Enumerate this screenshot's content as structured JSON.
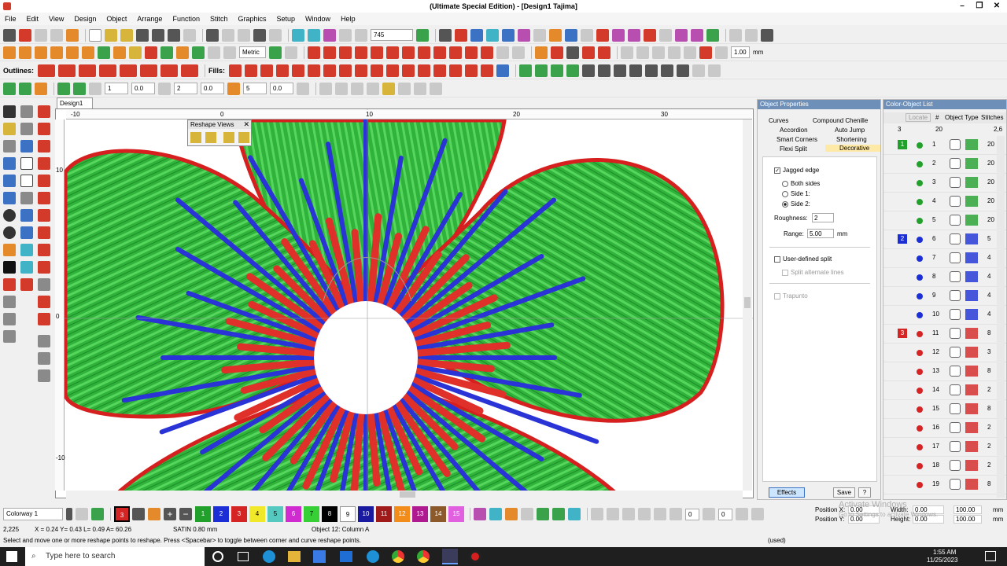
{
  "window": {
    "title": "(Ultimate Special Edition) - [Design1          Tajima]"
  },
  "menubar": {
    "items": [
      "File",
      "Edit",
      "View",
      "Design",
      "Object",
      "Arrange",
      "Function",
      "Stitch",
      "Graphics",
      "Setup",
      "Window",
      "Help"
    ]
  },
  "toolbar": {
    "zoom_value": "745",
    "units_value": "Metric",
    "outlines_label": "Outlines:",
    "fills_label": "Fills:",
    "size_value": "1.00",
    "size_unit": "mm",
    "field1": "1",
    "field2": "0.0",
    "field3": "2",
    "field4": "0.0",
    "field5": "5",
    "field6": "0.0"
  },
  "document": {
    "tab_label": "Design1"
  },
  "reshape_views": {
    "title": "Reshape Views"
  },
  "rulers": {
    "h": [
      "-10",
      "0",
      "10",
      "20",
      "30"
    ],
    "v": [
      "10",
      "0",
      "-10"
    ]
  },
  "object_properties": {
    "title": "Object Properties",
    "tabs": [
      "Curves",
      "Compound Chenille",
      "Accordion",
      "Auto Jump",
      "Smart Corners",
      "Shortening",
      "Flexi Split",
      "Decorative"
    ],
    "jagged_edge_label": "Jagged edge",
    "both_sides_label": "Both sides",
    "side1_label": "Side 1:",
    "side2_label": "Side 2:",
    "roughness_label": "Roughness:",
    "roughness_value": "2",
    "range_label": "Range:",
    "range_value": "5.00",
    "range_unit": "mm",
    "user_defined_split_label": "User-defined split",
    "split_alternate_label": "Split alternate lines",
    "trapunto_label": "Trapunto",
    "effects_button": "Effects",
    "save_button": "Save",
    "help_button": "?"
  },
  "color_object_list": {
    "title": "Color-Object List",
    "locate_label": "Locate",
    "hash_header": "#",
    "type_header": "Object Type",
    "stitches_header": "Stitches",
    "count_left": "3",
    "count_mid": "20",
    "count_right": "2,6",
    "rows": [
      {
        "num": "1",
        "stitches": "20",
        "color": "#22a02c",
        "group": "1"
      },
      {
        "num": "2",
        "stitches": "20",
        "color": "#22a02c"
      },
      {
        "num": "3",
        "stitches": "20",
        "color": "#22a02c"
      },
      {
        "num": "4",
        "stitches": "20",
        "color": "#22a02c"
      },
      {
        "num": "5",
        "stitches": "20",
        "color": "#22a02c"
      },
      {
        "num": "6",
        "stitches": "5",
        "color": "#1c2fd6",
        "group": "2"
      },
      {
        "num": "7",
        "stitches": "4",
        "color": "#1c2fd6"
      },
      {
        "num": "8",
        "stitches": "4",
        "color": "#1c2fd6"
      },
      {
        "num": "9",
        "stitches": "4",
        "color": "#1c2fd6"
      },
      {
        "num": "10",
        "stitches": "4",
        "color": "#1c2fd6"
      },
      {
        "num": "11",
        "stitches": "8",
        "color": "#d42424",
        "group": "3"
      },
      {
        "num": "12",
        "stitches": "3",
        "color": "#d42424"
      },
      {
        "num": "13",
        "stitches": "8",
        "color": "#d42424"
      },
      {
        "num": "14",
        "stitches": "2",
        "color": "#d42424"
      },
      {
        "num": "15",
        "stitches": "8",
        "color": "#d42424"
      },
      {
        "num": "16",
        "stitches": "2",
        "color": "#d42424"
      },
      {
        "num": "17",
        "stitches": "2",
        "color": "#d42424"
      },
      {
        "num": "18",
        "stitches": "2",
        "color": "#d42424"
      },
      {
        "num": "19",
        "stitches": "8",
        "color": "#d42424"
      }
    ]
  },
  "colorway": {
    "label": "Colorway 1",
    "swatches": [
      {
        "n": "1",
        "c": "#22a02c"
      },
      {
        "n": "2",
        "c": "#1c2fd6"
      },
      {
        "n": "3",
        "c": "#d42424"
      },
      {
        "n": "4",
        "c": "#f2e82a"
      },
      {
        "n": "5",
        "c": "#55c8c0"
      },
      {
        "n": "6",
        "c": "#d02bd0"
      },
      {
        "n": "7",
        "c": "#36d036"
      },
      {
        "n": "8",
        "c": "#000000"
      },
      {
        "n": "9",
        "c": "#ffffff"
      },
      {
        "n": "10",
        "c": "#1a1aa0"
      },
      {
        "n": "11",
        "c": "#a01a1a"
      },
      {
        "n": "12",
        "c": "#f28c1a"
      },
      {
        "n": "13",
        "c": "#b01a90"
      },
      {
        "n": "14",
        "c": "#8c5a2a"
      },
      {
        "n": "15",
        "c": "#e060e0"
      }
    ],
    "current_color_number": "3",
    "stepper1_value": "0",
    "stepper2_value": "0"
  },
  "position": {
    "pos_x_label": "Position X:",
    "pos_y_label": "Position Y:",
    "pos_x_value": "0.00",
    "pos_y_value": "0.00",
    "width_label": "Width:",
    "height_label": "Height:",
    "width_value": "0.00",
    "height_value": "0.00",
    "pct_w": "100.00",
    "pct_h": "100.00",
    "unit": "mm",
    "watermark_line1": "Activate Windows",
    "watermark_line2": "Go to Settings to activate Windows."
  },
  "status": {
    "coords": "2,225",
    "xy": "X = 0.24 Y= 0.43 L= 0.49 A= 60.26",
    "type": "SATIN 0.80 mm",
    "object": "Object 12: Column A",
    "hint": "Select and move one or more reshape points to reshape. Press <Spacebar> to toggle between corner and curve reshape points.",
    "used": "(used)"
  },
  "taskbar": {
    "search_placeholder": "Type here to search",
    "time": "1:55 AM",
    "date": "11/25/2023"
  }
}
